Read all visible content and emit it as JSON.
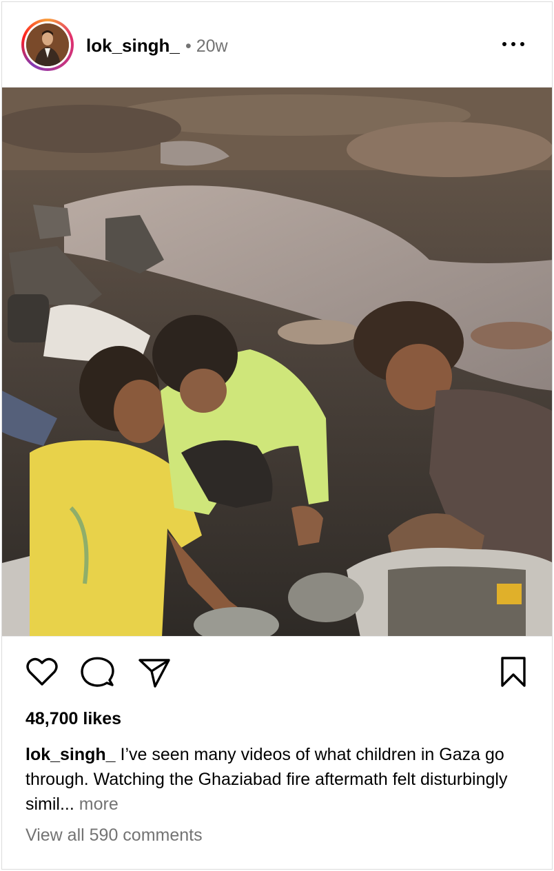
{
  "post": {
    "username": "lok_singh_",
    "time": "• 20w",
    "likes": "48,700 likes",
    "caption_user": "lok_singh_",
    "caption_text": " I’ve seen many videos of what children in Gaza go through. Watching the Ghaziabad fire aftermath felt disturbingly simil...",
    "more_label": " more",
    "comments_label": "View all 590 comments"
  },
  "icons": {
    "menu": "more-horizontal-icon",
    "like": "heart-icon",
    "comment": "comment-bubble-icon",
    "share": "paper-plane-icon",
    "save": "bookmark-icon"
  },
  "colors": {
    "text": "#000000",
    "secondary": "#737373",
    "border": "#dbdbdb"
  }
}
